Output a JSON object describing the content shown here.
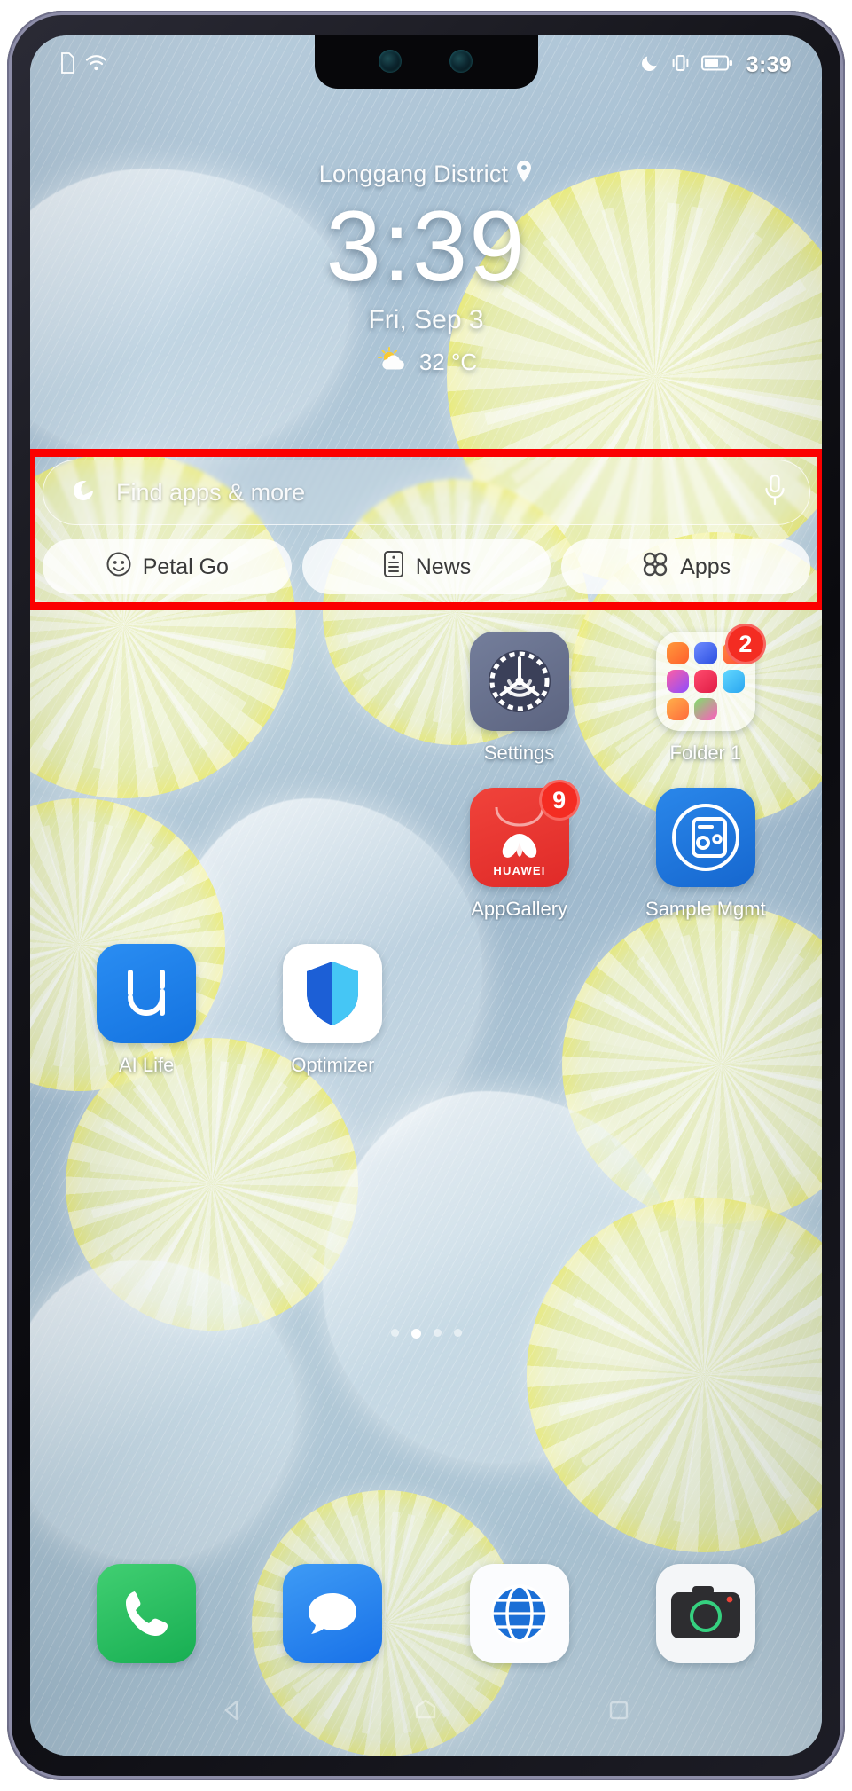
{
  "status_bar": {
    "left_icons": [
      {
        "name": "sim-card-icon",
        "glyph": "sim"
      },
      {
        "name": "wifi-icon",
        "glyph": "wifi"
      }
    ],
    "right_icons": [
      {
        "name": "do-not-disturb-icon",
        "glyph": "moon"
      },
      {
        "name": "vibrate-icon",
        "glyph": "vibrate"
      },
      {
        "name": "battery-icon",
        "glyph": "battery"
      }
    ],
    "time": "3:39"
  },
  "clock_widget": {
    "location": "Longgang District",
    "time": "3:39",
    "date": "Fri, Sep 3",
    "temperature": "32 °C",
    "weather_icon": "partly-cloudy-icon"
  },
  "search_widget": {
    "placeholder": "Find apps & more",
    "search_icon": "petal-search-icon",
    "mic_icon": "microphone-icon",
    "highlight_color": "#fb0000",
    "quick_actions": [
      {
        "label": "Petal Go",
        "icon": "petal-go-face-icon"
      },
      {
        "label": "News",
        "icon": "news-document-icon"
      },
      {
        "label": "Apps",
        "icon": "apps-grid-icon"
      }
    ]
  },
  "home_screen": {
    "rows": [
      {
        "apps": [
          {
            "label": "",
            "icon": "",
            "type": "empty"
          },
          {
            "label": "",
            "icon": "",
            "type": "empty"
          },
          {
            "label": "Settings",
            "icon": "settings-gear-icon",
            "type": "settings",
            "badge": ""
          },
          {
            "label": "Folder 1",
            "icon": "folder-icon",
            "type": "folder",
            "badge": "2"
          }
        ]
      },
      {
        "apps": [
          {
            "label": "",
            "icon": "",
            "type": "empty"
          },
          {
            "label": "",
            "icon": "",
            "type": "empty"
          },
          {
            "label": "AppGallery",
            "icon": "huawei-appgallery-icon",
            "type": "appgallery",
            "badge": "9"
          },
          {
            "label": "Sample Mgmt",
            "icon": "sample-mgmt-icon",
            "type": "samplemgmt",
            "badge": ""
          }
        ]
      },
      {
        "apps": [
          {
            "label": "AI Life",
            "icon": "ai-life-icon",
            "type": "ailife",
            "badge": ""
          },
          {
            "label": "Optimizer",
            "icon": "optimizer-shield-icon",
            "type": "optimizer",
            "badge": ""
          },
          {
            "label": "",
            "icon": "",
            "type": "empty"
          },
          {
            "label": "",
            "icon": "",
            "type": "empty"
          }
        ]
      }
    ]
  },
  "dock": {
    "apps": [
      {
        "label": "",
        "icon": "phone-icon",
        "type": "phone"
      },
      {
        "label": "",
        "icon": "messages-icon",
        "type": "messages"
      },
      {
        "label": "",
        "icon": "browser-globe-icon",
        "type": "browser"
      },
      {
        "label": "",
        "icon": "camera-icon",
        "type": "camera"
      }
    ]
  },
  "page_indicator": {
    "pages": 4,
    "active": 1
  },
  "nav_bar": {
    "buttons": [
      {
        "label": "",
        "icon": "back-triangle-icon"
      },
      {
        "label": "",
        "icon": "home-circle-icon"
      },
      {
        "label": "",
        "icon": "recents-square-icon"
      }
    ]
  }
}
